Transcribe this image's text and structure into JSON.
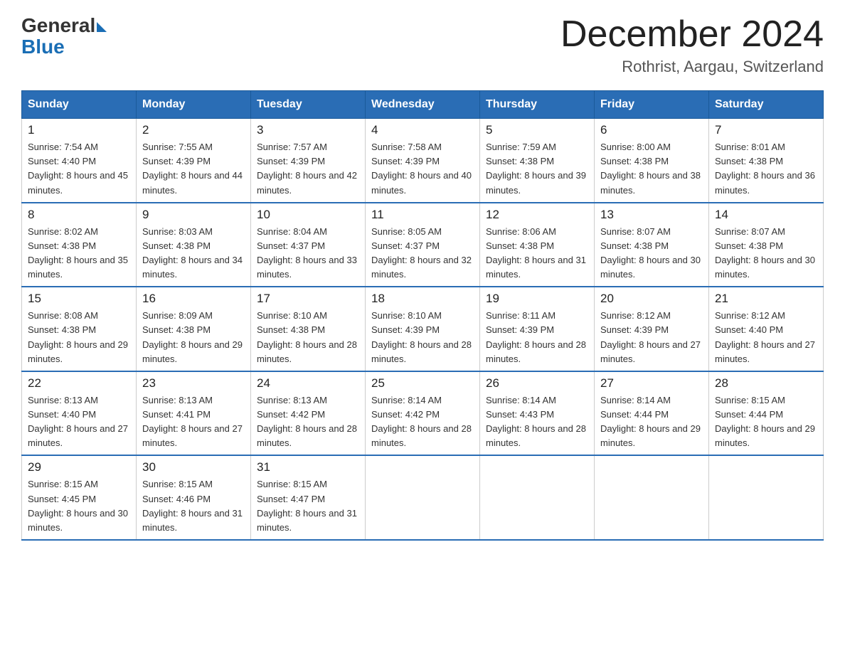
{
  "header": {
    "logo_general": "General",
    "logo_blue": "Blue",
    "title": "December 2024",
    "subtitle": "Rothrist, Aargau, Switzerland"
  },
  "weekdays": [
    "Sunday",
    "Monday",
    "Tuesday",
    "Wednesday",
    "Thursday",
    "Friday",
    "Saturday"
  ],
  "weeks": [
    [
      {
        "day": "1",
        "sunrise": "7:54 AM",
        "sunset": "4:40 PM",
        "daylight": "8 hours and 45 minutes."
      },
      {
        "day": "2",
        "sunrise": "7:55 AM",
        "sunset": "4:39 PM",
        "daylight": "8 hours and 44 minutes."
      },
      {
        "day": "3",
        "sunrise": "7:57 AM",
        "sunset": "4:39 PM",
        "daylight": "8 hours and 42 minutes."
      },
      {
        "day": "4",
        "sunrise": "7:58 AM",
        "sunset": "4:39 PM",
        "daylight": "8 hours and 40 minutes."
      },
      {
        "day": "5",
        "sunrise": "7:59 AM",
        "sunset": "4:38 PM",
        "daylight": "8 hours and 39 minutes."
      },
      {
        "day": "6",
        "sunrise": "8:00 AM",
        "sunset": "4:38 PM",
        "daylight": "8 hours and 38 minutes."
      },
      {
        "day": "7",
        "sunrise": "8:01 AM",
        "sunset": "4:38 PM",
        "daylight": "8 hours and 36 minutes."
      }
    ],
    [
      {
        "day": "8",
        "sunrise": "8:02 AM",
        "sunset": "4:38 PM",
        "daylight": "8 hours and 35 minutes."
      },
      {
        "day": "9",
        "sunrise": "8:03 AM",
        "sunset": "4:38 PM",
        "daylight": "8 hours and 34 minutes."
      },
      {
        "day": "10",
        "sunrise": "8:04 AM",
        "sunset": "4:37 PM",
        "daylight": "8 hours and 33 minutes."
      },
      {
        "day": "11",
        "sunrise": "8:05 AM",
        "sunset": "4:37 PM",
        "daylight": "8 hours and 32 minutes."
      },
      {
        "day": "12",
        "sunrise": "8:06 AM",
        "sunset": "4:38 PM",
        "daylight": "8 hours and 31 minutes."
      },
      {
        "day": "13",
        "sunrise": "8:07 AM",
        "sunset": "4:38 PM",
        "daylight": "8 hours and 30 minutes."
      },
      {
        "day": "14",
        "sunrise": "8:07 AM",
        "sunset": "4:38 PM",
        "daylight": "8 hours and 30 minutes."
      }
    ],
    [
      {
        "day": "15",
        "sunrise": "8:08 AM",
        "sunset": "4:38 PM",
        "daylight": "8 hours and 29 minutes."
      },
      {
        "day": "16",
        "sunrise": "8:09 AM",
        "sunset": "4:38 PM",
        "daylight": "8 hours and 29 minutes."
      },
      {
        "day": "17",
        "sunrise": "8:10 AM",
        "sunset": "4:38 PM",
        "daylight": "8 hours and 28 minutes."
      },
      {
        "day": "18",
        "sunrise": "8:10 AM",
        "sunset": "4:39 PM",
        "daylight": "8 hours and 28 minutes."
      },
      {
        "day": "19",
        "sunrise": "8:11 AM",
        "sunset": "4:39 PM",
        "daylight": "8 hours and 28 minutes."
      },
      {
        "day": "20",
        "sunrise": "8:12 AM",
        "sunset": "4:39 PM",
        "daylight": "8 hours and 27 minutes."
      },
      {
        "day": "21",
        "sunrise": "8:12 AM",
        "sunset": "4:40 PM",
        "daylight": "8 hours and 27 minutes."
      }
    ],
    [
      {
        "day": "22",
        "sunrise": "8:13 AM",
        "sunset": "4:40 PM",
        "daylight": "8 hours and 27 minutes."
      },
      {
        "day": "23",
        "sunrise": "8:13 AM",
        "sunset": "4:41 PM",
        "daylight": "8 hours and 27 minutes."
      },
      {
        "day": "24",
        "sunrise": "8:13 AM",
        "sunset": "4:42 PM",
        "daylight": "8 hours and 28 minutes."
      },
      {
        "day": "25",
        "sunrise": "8:14 AM",
        "sunset": "4:42 PM",
        "daylight": "8 hours and 28 minutes."
      },
      {
        "day": "26",
        "sunrise": "8:14 AM",
        "sunset": "4:43 PM",
        "daylight": "8 hours and 28 minutes."
      },
      {
        "day": "27",
        "sunrise": "8:14 AM",
        "sunset": "4:44 PM",
        "daylight": "8 hours and 29 minutes."
      },
      {
        "day": "28",
        "sunrise": "8:15 AM",
        "sunset": "4:44 PM",
        "daylight": "8 hours and 29 minutes."
      }
    ],
    [
      {
        "day": "29",
        "sunrise": "8:15 AM",
        "sunset": "4:45 PM",
        "daylight": "8 hours and 30 minutes."
      },
      {
        "day": "30",
        "sunrise": "8:15 AM",
        "sunset": "4:46 PM",
        "daylight": "8 hours and 31 minutes."
      },
      {
        "day": "31",
        "sunrise": "8:15 AM",
        "sunset": "4:47 PM",
        "daylight": "8 hours and 31 minutes."
      },
      null,
      null,
      null,
      null
    ]
  ]
}
